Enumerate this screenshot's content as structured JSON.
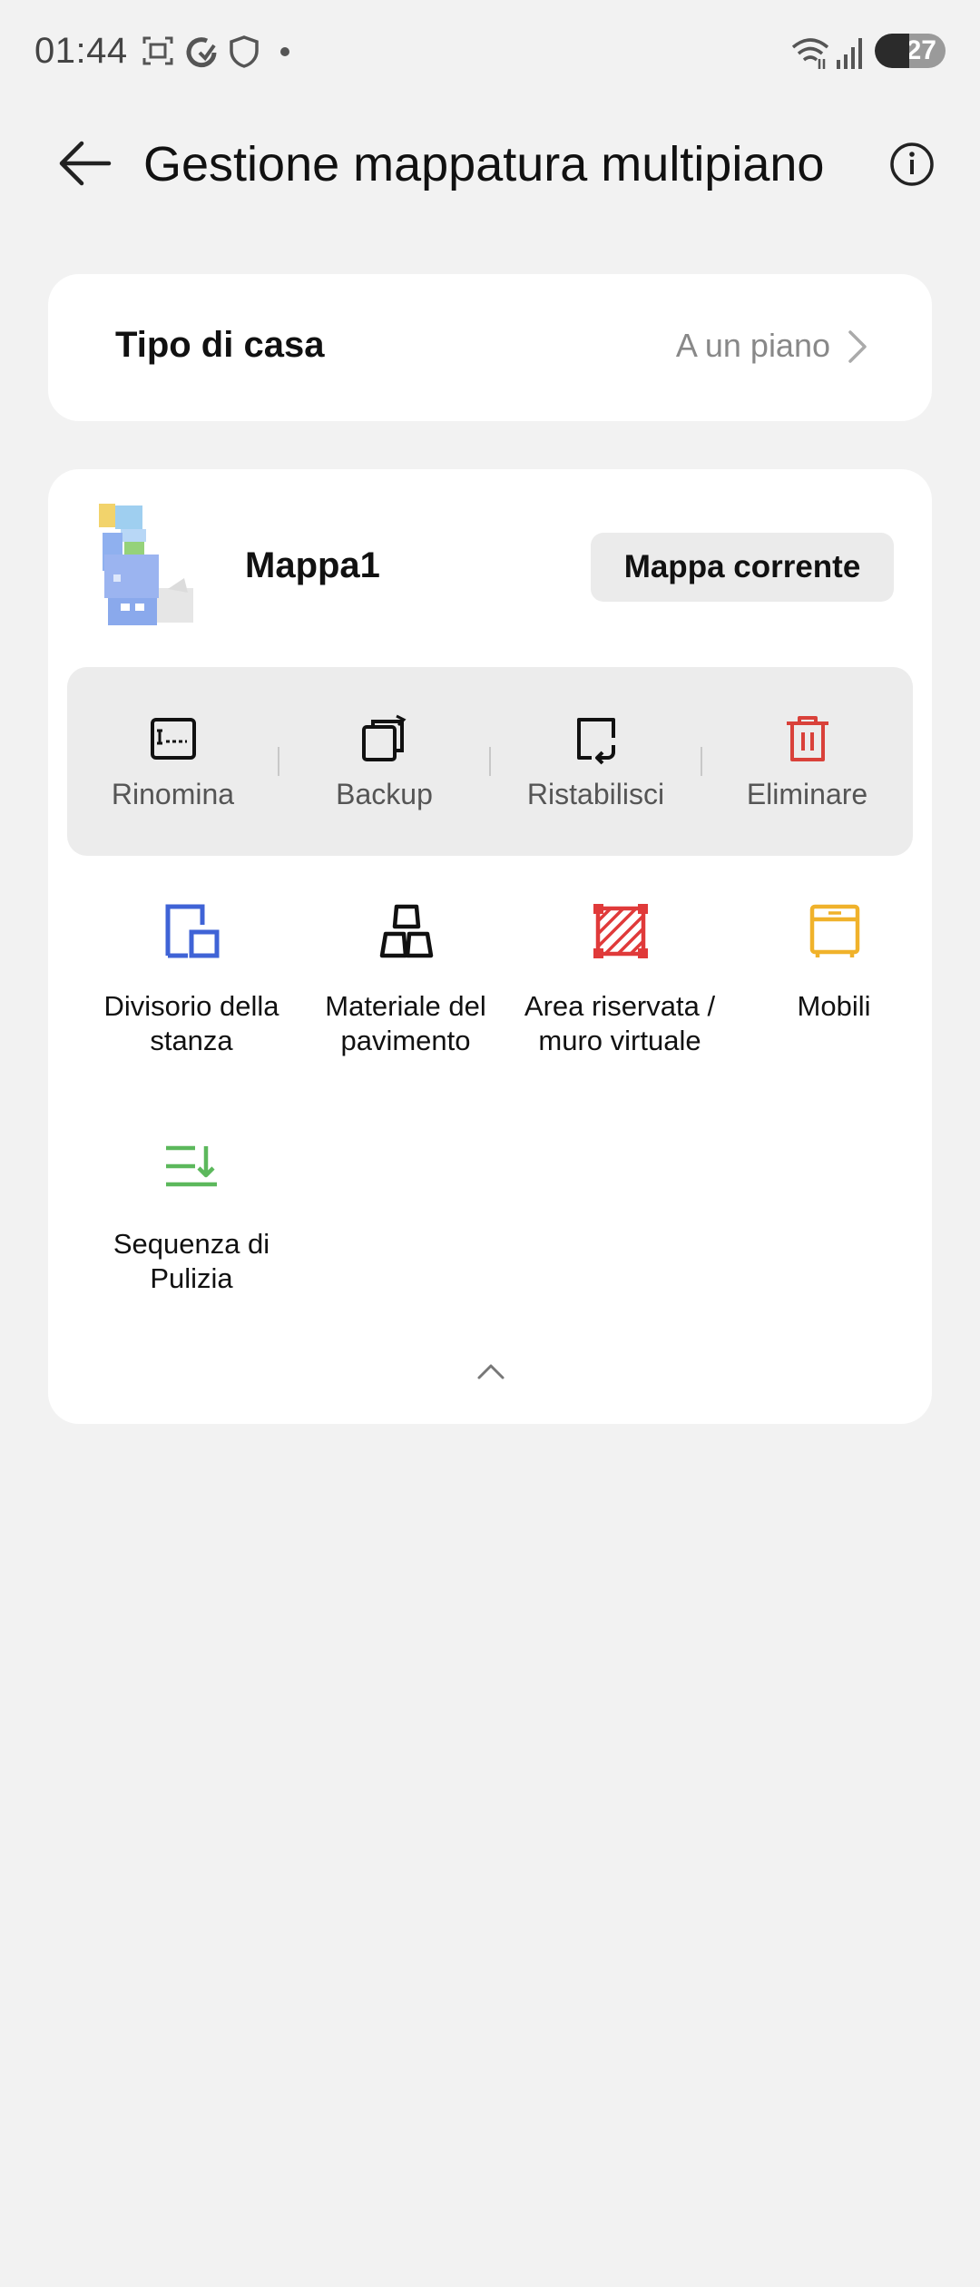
{
  "status_bar": {
    "time": "01:44",
    "battery": "27"
  },
  "header": {
    "title": "Gestione mappatura multipiano"
  },
  "home_type": {
    "label": "Tipo di casa",
    "value": "A un piano"
  },
  "map": {
    "name": "Mappa1",
    "current_label": "Mappa corrente",
    "actions": [
      {
        "label": "Rinomina",
        "icon": "rename-icon"
      },
      {
        "label": "Backup",
        "icon": "backup-icon"
      },
      {
        "label": "Ristabilisci",
        "icon": "restore-icon"
      },
      {
        "label": "Eliminare",
        "icon": "trash-icon"
      }
    ],
    "features": [
      {
        "line1": "Divisorio della",
        "line2": "stanza",
        "icon": "room-divider-icon"
      },
      {
        "line1": "Materiale del",
        "line2": "pavimento",
        "icon": "floor-material-icon"
      },
      {
        "line1": "Area riservata /",
        "line2": "muro virtuale",
        "icon": "no-go-zone-icon"
      },
      {
        "line1": "Mobili",
        "line2": "",
        "icon": "furniture-icon"
      },
      {
        "line1": "Sequenza di",
        "line2": "Pulizia",
        "icon": "cleaning-sequence-icon"
      }
    ]
  },
  "colors": {
    "background": "#f2f2f2",
    "card": "#ffffff",
    "delete_red": "#d9413a",
    "divider_blue": "#3f63d6",
    "zone_red": "#e03a3a",
    "furniture_yellow": "#f0b22b",
    "sequence_green": "#5cb85c"
  }
}
